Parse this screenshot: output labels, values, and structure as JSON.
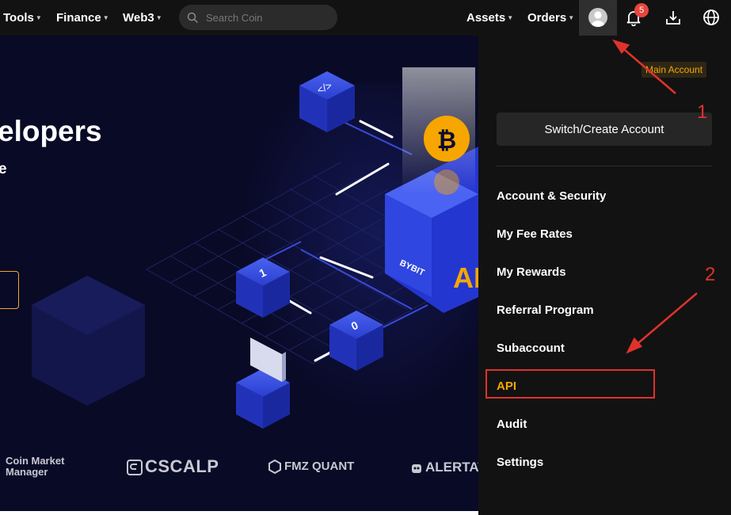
{
  "topnav": {
    "items": [
      {
        "label": "Tools"
      },
      {
        "label": "Finance"
      },
      {
        "label": "Web3"
      },
      {
        "label": "Assets"
      },
      {
        "label": "Orders"
      }
    ],
    "search": {
      "placeholder": "Search Coin",
      "icon": "search-icon"
    },
    "notification_count": "5",
    "icons": [
      "avatar-icon",
      "bell-icon",
      "download-icon",
      "globe-icon"
    ]
  },
  "hero": {
    "title": "elopers",
    "subtitle": "e",
    "art_labels": {
      "brand": "BYBIT",
      "api": "API",
      "glyph_one": "1",
      "glyph_zero": "0"
    },
    "partners": [
      {
        "line1": "Coin Market",
        "line2": "Manager"
      },
      {
        "name": "CSCALP"
      },
      {
        "name": "FMZ QUANT"
      },
      {
        "name": "ALERTAT"
      }
    ]
  },
  "dropdown": {
    "account_tag": "Main Account",
    "switch_button": "Switch/Create Account",
    "menu": [
      {
        "label": "Account & Security"
      },
      {
        "label": "My Fee Rates"
      },
      {
        "label": "My Rewards"
      },
      {
        "label": "Referral Program"
      },
      {
        "label": "Subaccount"
      },
      {
        "label": "API"
      },
      {
        "label": "Audit"
      },
      {
        "label": "Settings"
      }
    ]
  },
  "annotations": {
    "step1": "1",
    "step2": "2"
  },
  "colors": {
    "accent": "#f7a600",
    "annotation": "#e0322c",
    "nav_bg": "#121212",
    "hero_bg": "#090a26"
  }
}
